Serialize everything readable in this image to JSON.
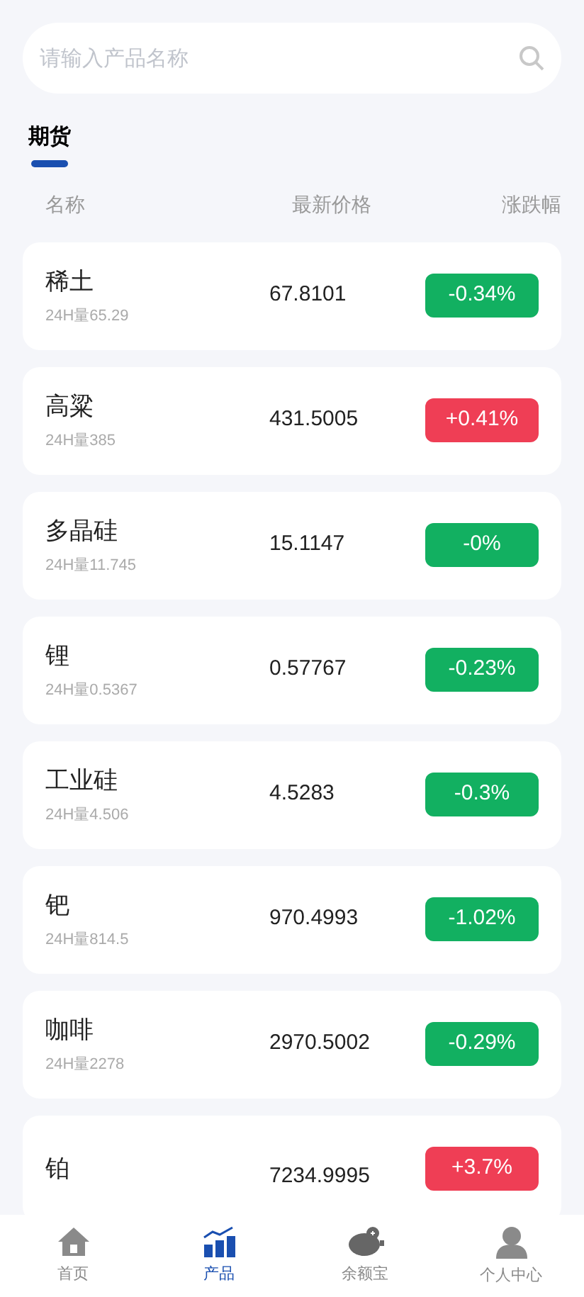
{
  "search": {
    "placeholder": "请输入产品名称"
  },
  "tabs": [
    {
      "label": "期货",
      "selected": true
    }
  ],
  "columns": [
    "名称",
    "最新价格",
    "涨跌幅"
  ],
  "rows": [
    {
      "name": "稀土",
      "volume": "24H量65.29",
      "price": "67.8101",
      "change": "-0.34%",
      "color": "#12b061"
    },
    {
      "name": "高粱",
      "volume": "24H量385",
      "price": "431.5005",
      "change": "+0.41%",
      "color": "#ef3e55"
    },
    {
      "name": "多晶硅",
      "volume": "24H量11.745",
      "price": "15.1147",
      "change": "-0%",
      "color": "#12b061"
    },
    {
      "name": "锂",
      "volume": "24H量0.5367",
      "price": "0.57767",
      "change": "-0.23%",
      "color": "#12b061"
    },
    {
      "name": "工业硅",
      "volume": "24H量4.506",
      "price": "4.5283",
      "change": "-0.3%",
      "color": "#12b061"
    },
    {
      "name": "钯",
      "volume": "24H量814.5",
      "price": "970.4993",
      "change": "-1.02%",
      "color": "#12b061"
    },
    {
      "name": "咖啡",
      "volume": "24H量2278",
      "price": "2970.5002",
      "change": "-0.29%",
      "color": "#12b061"
    },
    {
      "name": "铂",
      "price": "7234.9995",
      "change": "+3.7%",
      "color": "#ef3e55"
    }
  ],
  "nav": [
    {
      "label": "首页",
      "selected": false
    },
    {
      "label": "产品",
      "selected": true
    },
    {
      "label": "余额宝",
      "selected": false
    },
    {
      "label": "个人中心",
      "selected": false
    }
  ]
}
